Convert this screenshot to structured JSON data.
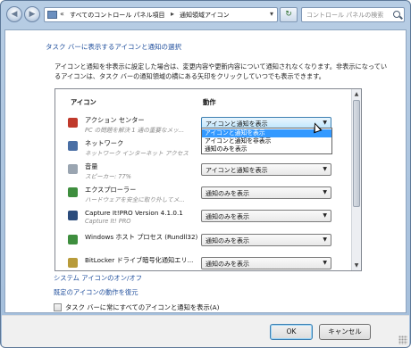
{
  "address_bar": {
    "chevrons": "«",
    "crumbs": [
      "すべてのコントロール パネル項目",
      "通知領域アイコン"
    ],
    "separator": "▸"
  },
  "search": {
    "placeholder": "コントロール パネルの検索"
  },
  "heading": "タスク バーに表示するアイコンと通知の選択",
  "description": "アイコンと通知を非表示に設定した場合は、変更内容や更新内容について通知されなくなります。非表示になっているアイコンは、タスク バーの通知領域の横にある矢印をクリックしていつでも表示できます。",
  "columns": {
    "icon": "アイコン",
    "behavior": "動作"
  },
  "rows": [
    {
      "name": "アクション センター",
      "sub": "PC の問題を解決 1 通の重要なメッ...",
      "value": "アイコンと通知を表示",
      "icon": "action-center-flag-icon",
      "color": "#c0392b"
    },
    {
      "name": "ネットワーク",
      "sub": "ネットワーク インターネット アクセス",
      "value": "",
      "icon": "network-icon",
      "color": "#4a6fa5"
    },
    {
      "name": "音量",
      "sub": "スピーカー: 77%",
      "value": "アイコンと通知を表示",
      "icon": "speaker-icon",
      "color": "#9aa5b1"
    },
    {
      "name": "エクスプローラー",
      "sub": "ハードウェアを安全に取り外してメ...",
      "value": "通知のみを表示",
      "icon": "usb-device-icon",
      "color": "#3e8e3e"
    },
    {
      "name": "Capture It!PRO Version 4.1.0.1",
      "sub": "Capture It! PRO",
      "value": "通知のみを表示",
      "icon": "capture-icon",
      "color": "#2c4c7c"
    },
    {
      "name": "Windows ホスト プロセス (Rundll32)",
      "sub": "",
      "value": "通知のみを表示",
      "icon": "rundll-icon",
      "color": "#3e8e3e"
    },
    {
      "name": "BitLocker ドライブ暗号化通知エリ...",
      "sub": "",
      "value": "通知のみを表示",
      "icon": "bitlocker-icon",
      "color": "#b89b3a"
    }
  ],
  "dropdown_options": [
    "アイコンと通知を表示",
    "アイコンと通知を非表示",
    "通知のみを表示"
  ],
  "dropdown_selected_index": 0,
  "links": {
    "system_icons": "システム アイコンのオン/オフ",
    "restore_defaults": "既定のアイコンの動作を復元"
  },
  "always_show": {
    "label": "タスク バーに常にすべてのアイコンと通知を表示(A)",
    "checked": false
  },
  "buttons": {
    "ok": "OK",
    "cancel": "キャンセル"
  },
  "nav": {
    "back": "◀",
    "forward": "▶",
    "refresh": "↻",
    "dropdown": "▾",
    "combo_arrow": "▼",
    "scroll_up": "▲",
    "scroll_down": "▼"
  }
}
